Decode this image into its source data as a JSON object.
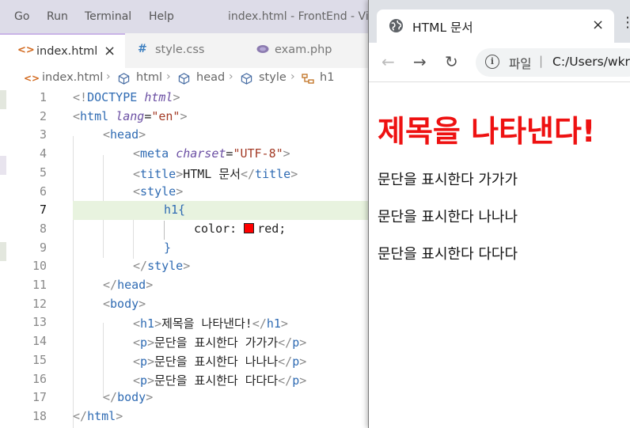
{
  "menubar": {
    "items": [
      "Go",
      "Run",
      "Terminal",
      "Help"
    ],
    "window_title": "index.html - FrontEnd - Vis"
  },
  "tabs": [
    {
      "label": "index.html",
      "icon": "html-file-icon",
      "close": "×"
    },
    {
      "label": "style.css",
      "icon": "css-file-icon",
      "prefix": "#"
    },
    {
      "label": "exam.php",
      "icon": "php-file-icon"
    }
  ],
  "breadcrumb": [
    "index.html",
    "html",
    "head",
    "style",
    "h1"
  ],
  "editor": {
    "line_numbers": [
      "1",
      "2",
      "3",
      "4",
      "5",
      "6",
      "7",
      "8",
      "9",
      "10",
      "11",
      "12",
      "13",
      "14",
      "15",
      "16",
      "17",
      "18"
    ],
    "current_line": "7",
    "color_swatch": "#ff0000",
    "code": {
      "l1": {
        "open": "<!",
        "kw": "DOCTYPE",
        "attr": "html",
        "close": ">"
      },
      "l2": {
        "tag": "html",
        "attr": "lang",
        "val": "\"en\""
      },
      "l3": {
        "tag": "head"
      },
      "l4": {
        "tag": "meta",
        "attr": "charset",
        "val": "\"UTF-8\""
      },
      "l5": {
        "tag": "title",
        "text": "HTML 문서",
        "endtag": "title"
      },
      "l6": {
        "tag": "style"
      },
      "l7": {
        "selector": "h1{"
      },
      "l8": {
        "prop": "color:",
        "value": "red;"
      },
      "l9": {
        "brace": "}"
      },
      "l10": {
        "endtag": "style"
      },
      "l11": {
        "endtag": "head"
      },
      "l12": {
        "tag": "body"
      },
      "l13": {
        "tag": "h1",
        "text": "제목을 나타낸다!",
        "endtag": "h1"
      },
      "l14": {
        "tag": "p",
        "text": "문단을 표시한다 가가가",
        "endtag": "p"
      },
      "l15": {
        "tag": "p",
        "text": "문단을 표시한다 나나나",
        "endtag": "p"
      },
      "l16": {
        "tag": "p",
        "text": "문단을 표시한다 다다다",
        "endtag": "p"
      },
      "l17": {
        "endtag": "body"
      },
      "l18": {
        "endtag": "html"
      }
    }
  },
  "browser": {
    "tab_title": "HTML 문서",
    "tab_close": "×",
    "omnibox": {
      "scheme": "파일",
      "url": "C:/Users/wkr"
    },
    "page": {
      "h1": "제목을 나타낸다!",
      "paragraphs": [
        "문단을 표시한다 가가가",
        "문단을 표시한다 나나나",
        "문단을 표시한다 다다다"
      ]
    }
  },
  "colors": {
    "tag": "#2f6bb3",
    "attribute": "#6b4fa3",
    "string": "#a33a25",
    "h1_render": "#e11111"
  }
}
